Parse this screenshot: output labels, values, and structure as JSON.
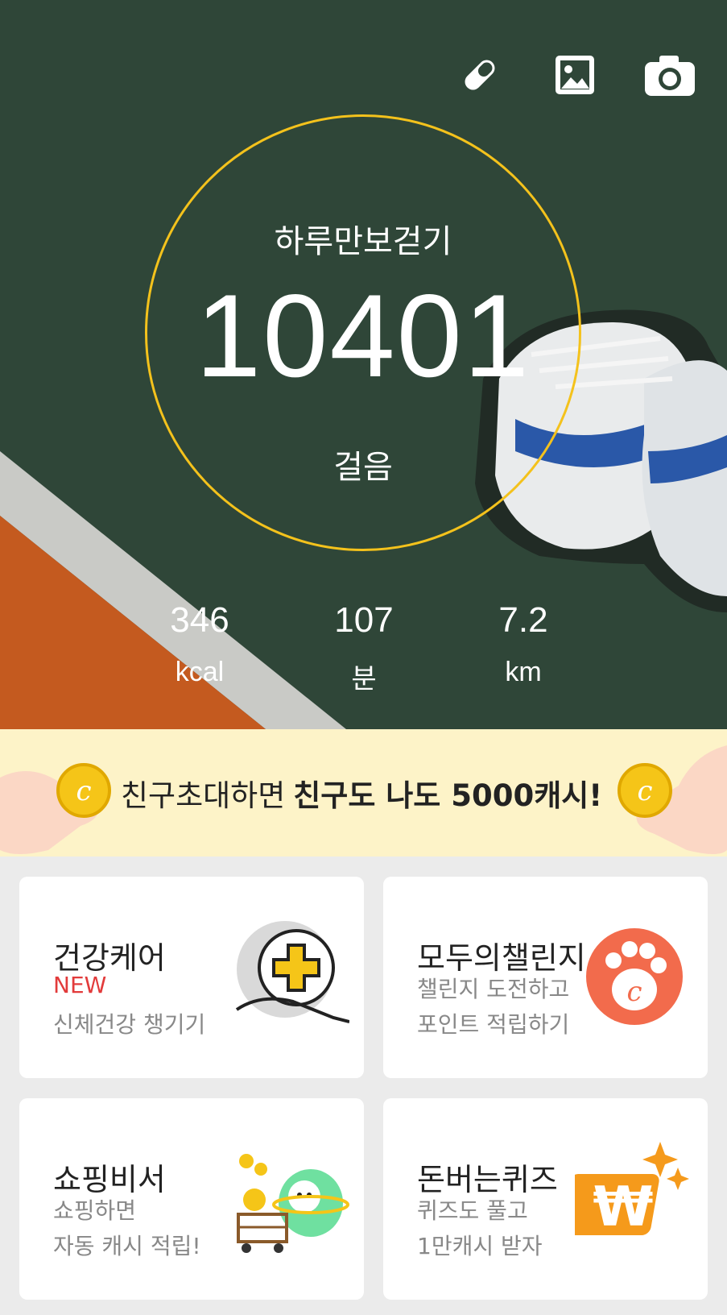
{
  "hero": {
    "title": "하루만보걷기",
    "steps": "10401",
    "steps_unit": "걸음",
    "stats": [
      {
        "value": "346",
        "unit": "kcal"
      },
      {
        "value": "107",
        "unit": "분"
      },
      {
        "value": "7.2",
        "unit": "km"
      }
    ],
    "ring_color": "#f4c21c"
  },
  "toolbar": {
    "icons": [
      "pill-icon",
      "image-icon",
      "camera-icon"
    ]
  },
  "banner": {
    "text": "친구초대하면",
    "highlight": "친구도 나도 5000캐시!"
  },
  "cards": [
    {
      "title": "건강케어",
      "badge": "NEW",
      "line1": "신체건강 챙기기",
      "icon": "health-plus-icon"
    },
    {
      "title": "모두의챌린지",
      "line1": "챌린지 도전하고",
      "line2": "포인트 적립하기",
      "icon": "paw-coin-icon"
    },
    {
      "title": "쇼핑비서",
      "line1": "쇼핑하면",
      "line2": "자동 캐시 적립!",
      "icon": "shopping-character-icon"
    },
    {
      "title": "돈버는퀴즈",
      "line1": "퀴즈도 풀고",
      "line2": "1만캐시 받자",
      "icon": "won-sparkle-icon"
    }
  ],
  "colors": {
    "accent": "#f4c21c",
    "new_badge": "#e23b3b",
    "paw": "#f26b4c",
    "quiz": "#f59a1b"
  }
}
